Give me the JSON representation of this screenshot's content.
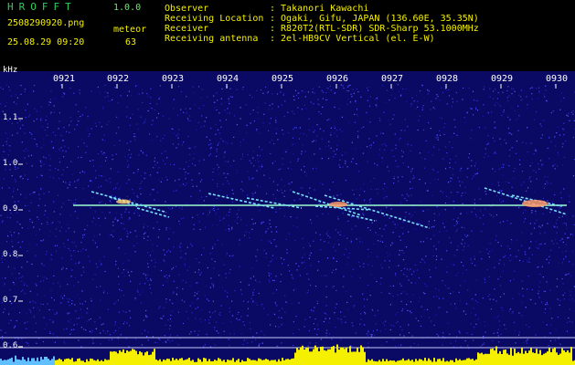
{
  "app": {
    "title": "HROFFT",
    "version": "1.0.0"
  },
  "file": {
    "name": "2508290920.png",
    "datetime": "25.08.29 09:20"
  },
  "detection": {
    "type": "meteor",
    "count": "63"
  },
  "info": [
    {
      "key": "Observer",
      "value": ": Takanori Kawachi"
    },
    {
      "key": "Receiving Location",
      "value": ": Ogaki, Gifu, JAPAN (136.60E, 35.35N)"
    },
    {
      "key": "Receiver",
      "value": ": R820T2(RTL-SDR) SDR-Sharp 53.1000MHz"
    },
    {
      "key": "Receiving antenna",
      "value": ": 2el-HB9CV Vertical (el. E-W)"
    }
  ],
  "axis": {
    "unit": "kHz",
    "time_ticks": [
      "0921",
      "0922",
      "0923",
      "0924",
      "0925",
      "0926",
      "0927",
      "0928",
      "0929",
      "0930"
    ],
    "freq_ticks": [
      "1.1",
      "1.0",
      "0.9",
      "0.8",
      "0.7",
      "0.6"
    ]
  },
  "colors": {
    "header_green": "#6ee86e",
    "header_yellow": "#f5f000",
    "background": "#0a0a64",
    "carrier": "#9cffd0"
  }
}
